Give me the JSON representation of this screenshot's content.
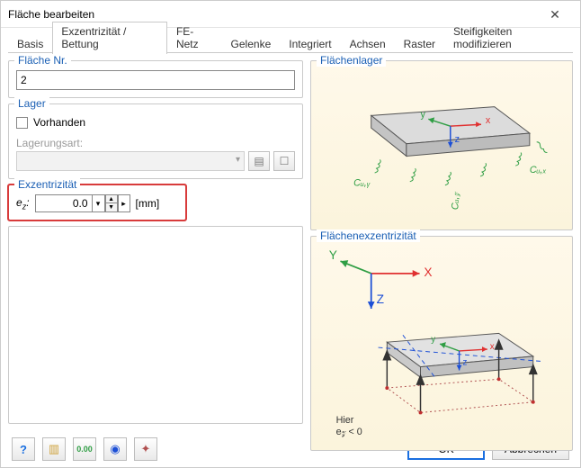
{
  "window": {
    "title": "Fläche bearbeiten"
  },
  "tabs": [
    {
      "label": "Basis"
    },
    {
      "label": "Exzentrizität / Bettung"
    },
    {
      "label": "FE-Netz"
    },
    {
      "label": "Gelenke"
    },
    {
      "label": "Integriert"
    },
    {
      "label": "Achsen"
    },
    {
      "label": "Raster"
    },
    {
      "label": "Steifigkeiten modifizieren"
    }
  ],
  "surface": {
    "legend": "Fläche Nr.",
    "value": "2"
  },
  "support": {
    "legend": "Lager",
    "present_label": "Vorhanden",
    "present_checked": false,
    "type_label": "Lagerungsart:"
  },
  "ecc": {
    "legend": "Exzentrizität",
    "param_html": "e<sub>z</sub>:",
    "param_prefix": "e",
    "param_sub": "z",
    "value": "0.0",
    "unit": "[mm]"
  },
  "preview": {
    "top_legend": "Flächenlager",
    "bottom_legend": "Flächenexzentrizität",
    "labels": {
      "x": "x",
      "y": "y",
      "z": "z",
      "X": "X",
      "Y": "Y",
      "Z": "Z",
      "cux": "Cᵤ,ₓ",
      "cuy": "Cᵤ,ᵧ",
      "cuz": "Cᵤ,𝓏",
      "here": "Hier",
      "ez_neg": "e𝓏 < 0"
    }
  },
  "buttons": {
    "ok": "OK",
    "cancel": "Abbrechen"
  },
  "colors": {
    "x_axis": "#e03131",
    "y_axis": "#2f9e44",
    "z_axis": "#1c4fd6",
    "highlight": "#d83b3b",
    "primary_border": "#1a6fe0"
  }
}
